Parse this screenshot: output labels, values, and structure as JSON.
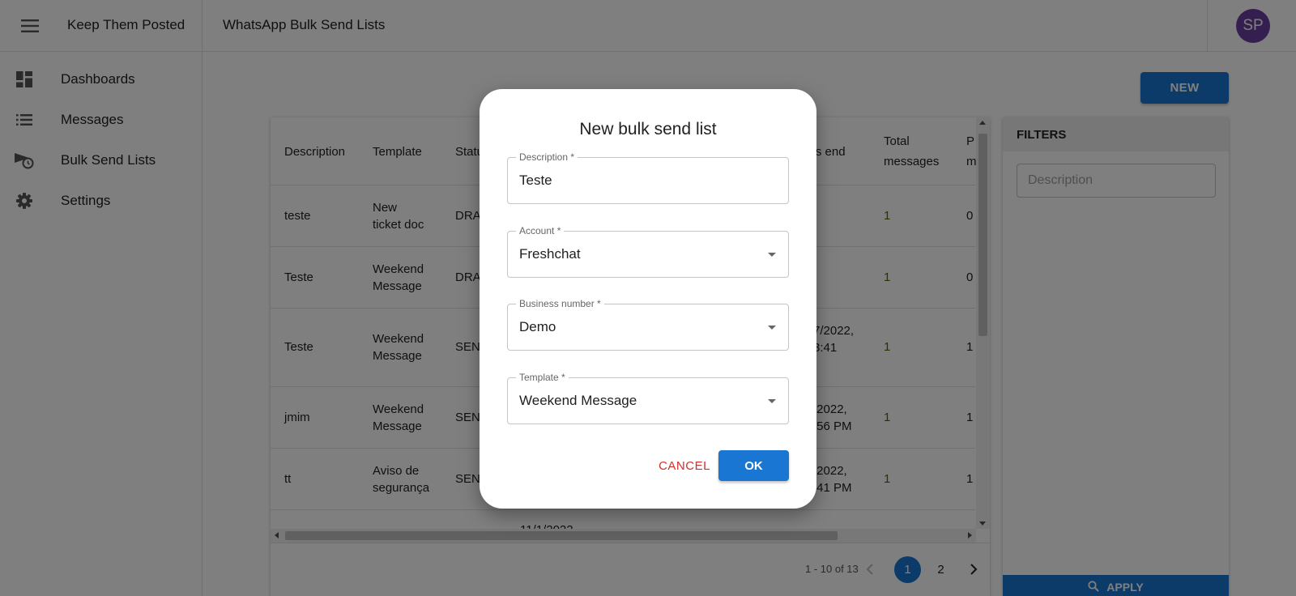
{
  "app": {
    "title": "Keep Them Posted",
    "page_title": "WhatsApp Bulk Send Lists",
    "user_initials": "SP"
  },
  "sidebar": {
    "items": [
      {
        "label": "Dashboards",
        "icon": "dashboard-icon"
      },
      {
        "label": "Messages",
        "icon": "list-icon"
      },
      {
        "label": "Bulk Send Lists",
        "icon": "scheduled-send-icon"
      },
      {
        "label": "Settings",
        "icon": "gear-icon"
      }
    ]
  },
  "toolbar": {
    "new_label": "NEW"
  },
  "table": {
    "headers": {
      "description": "Description",
      "template": "Template",
      "status": "Statu",
      "send_end": "'s end",
      "total_messages_1": "Total",
      "total_messages_2": "messages",
      "p_col_1": "P",
      "p_col_2": "m"
    },
    "rows": [
      {
        "description": "teste",
        "template_1": "New",
        "template_2": "ticket doc",
        "status": "DRA",
        "end_1": "",
        "end_2": "",
        "total": "1",
        "p": "0"
      },
      {
        "description": "Teste",
        "template_1": "Weekend",
        "template_2": "Message",
        "status": "DRA",
        "end_1": "",
        "end_2": "",
        "total": "1",
        "p": "0"
      },
      {
        "description": "Teste",
        "template_1": "Weekend",
        "template_2": "Message",
        "status": "SEN",
        "end_1": "7/2022,",
        "end_2": "3:41",
        "total": "1",
        "p": "1"
      },
      {
        "description": "jmim",
        "template_1": "Weekend",
        "template_2": "Message",
        "status": "SEN",
        "end_1": "/2022,",
        "end_2": ":56 PM",
        "total": "1",
        "p": "1"
      },
      {
        "description": "tt",
        "template_1": "Aviso de",
        "template_2": "segurança",
        "status": "SEN",
        "end_1": "/2022,",
        "end_2": ":41 PM",
        "total": "1",
        "p": "1"
      }
    ],
    "partial_row_text": "11/1/2022"
  },
  "pagination": {
    "range": "1 - 10 of 13",
    "pages": [
      "1",
      "2"
    ],
    "current": "1"
  },
  "filters": {
    "title": "FILTERS",
    "description_placeholder": "Description",
    "apply_label": "APPLY"
  },
  "dialog": {
    "title": "New bulk send list",
    "fields": {
      "description": {
        "label": "Description *",
        "value": "Teste"
      },
      "account": {
        "label": "Account *",
        "value": "Freshchat"
      },
      "business_number": {
        "label": "Business number *",
        "value": "Demo"
      },
      "template": {
        "label": "Template *",
        "value": "Weekend Message"
      }
    },
    "cancel_label": "CANCEL",
    "ok_label": "OK"
  },
  "colors": {
    "primary": "#1976d2",
    "cancel": "#d32f2f",
    "avatar": "#6b3fa0",
    "overlay": "rgba(0,0,0,0.5)"
  }
}
